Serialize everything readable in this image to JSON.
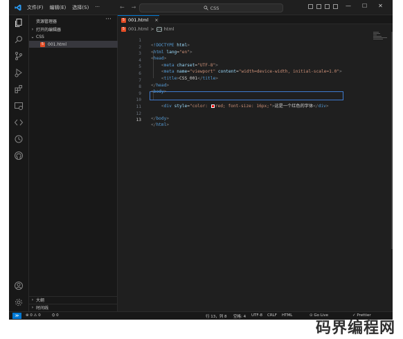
{
  "titlebar": {
    "menu": [
      "文件(F)",
      "编辑(E)",
      "选择(S)"
    ],
    "more": "···",
    "nav_back": "←",
    "nav_forward": "→",
    "search_text": "CSS",
    "win_min": "—",
    "win_max": "☐",
    "win_close": "✕"
  },
  "sidebar": {
    "title": "资源管理器",
    "dots": "···",
    "open_editors": "打开的编辑器",
    "folder": "CSS",
    "file": "001.html",
    "outline": "大纲",
    "timeline": "时间线"
  },
  "tab": {
    "label": "001.html",
    "close": "×"
  },
  "breadcrumb": {
    "file": "001.html",
    "sep": ">",
    "element": "html"
  },
  "code": {
    "lines": [
      "1",
      "2",
      "3",
      "4",
      "5",
      "6",
      "7",
      "8",
      "9",
      "10",
      "11",
      "12",
      "13"
    ]
  },
  "statusbar": {
    "remote": "≫",
    "problems": "⊗ 0 ⚠ 0",
    "ports": "⛭ 0",
    "cursor": "行 13，列 8",
    "spaces": "空格: 4",
    "encoding": "UTF-8",
    "eol": "CRLF",
    "language": "HTML",
    "golive": "⊙ Go Live",
    "prettier": "✓ Prettier"
  },
  "watermark": "码界编程网",
  "colors": {
    "accent": "#0078d4",
    "html_icon": "#e44d26",
    "tag": "#569cd6",
    "attr": "#9cdcfe",
    "string": "#ce9178"
  }
}
